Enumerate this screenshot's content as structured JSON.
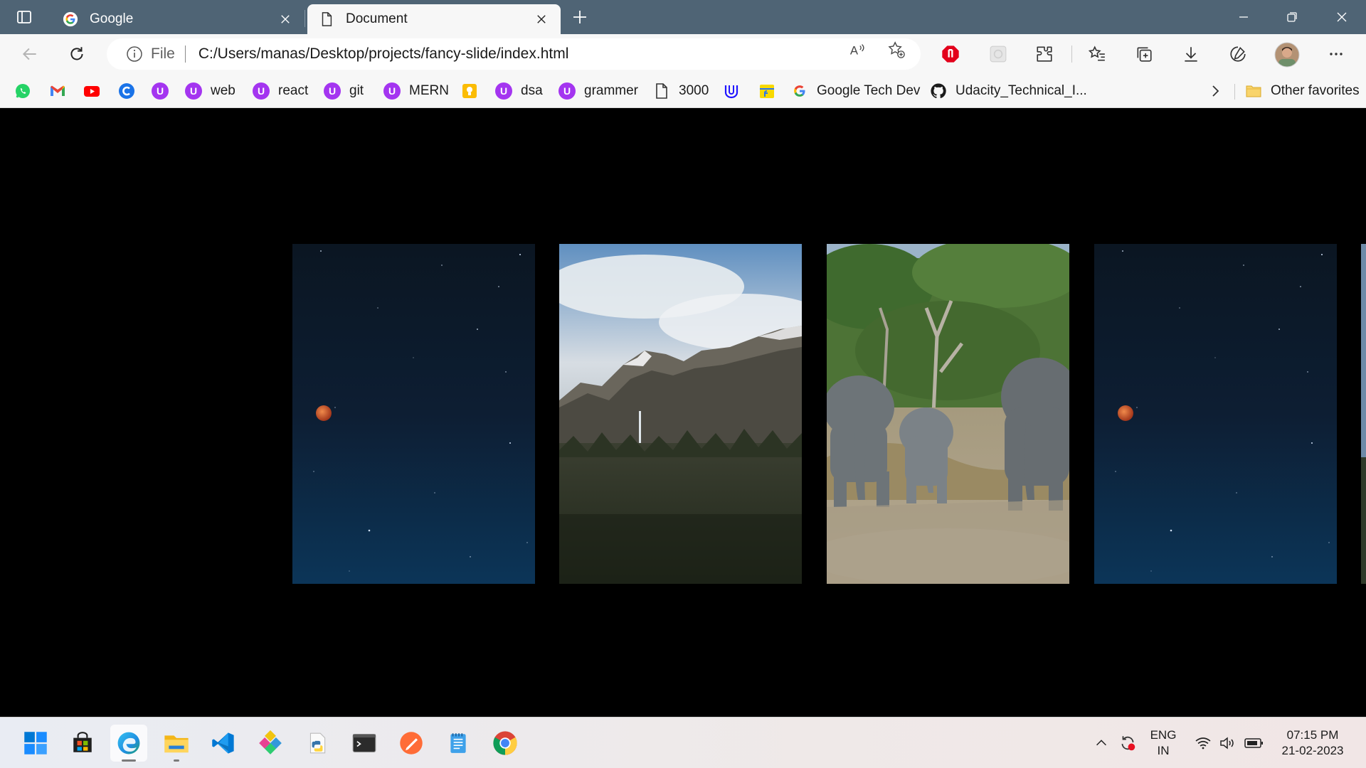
{
  "browser": {
    "tabs": [
      {
        "title": "Google",
        "favicon": "google-icon",
        "active": false
      },
      {
        "title": "Document",
        "favicon": "document-icon",
        "active": true
      }
    ],
    "address": {
      "scheme_label": "File",
      "url": "C:/Users/manas/Desktop/projects/fancy-slide/index.html"
    },
    "toolbar_icons": [
      "back-icon",
      "refresh-icon",
      "read-aloud-icon",
      "add-favorite-icon",
      "adblock-icon",
      "extension-placeholder-icon",
      "extensions-icon",
      "favorites-icon",
      "collections-icon",
      "downloads-icon",
      "performance-icon",
      "profile-avatar",
      "more-icon"
    ],
    "bookmarks": [
      {
        "label": "",
        "icon": "whatsapp-icon"
      },
      {
        "label": "",
        "icon": "gmail-icon"
      },
      {
        "label": "",
        "icon": "youtube-icon"
      },
      {
        "label": "",
        "icon": "c-app-icon"
      },
      {
        "label": "",
        "icon": "udemy-icon"
      },
      {
        "label": "web",
        "icon": "udemy-icon"
      },
      {
        "label": "react",
        "icon": "udemy-icon"
      },
      {
        "label": "git",
        "icon": "udemy-icon"
      },
      {
        "label": "MERN",
        "icon": "udemy-icon"
      },
      {
        "label": "",
        "icon": "keep-icon"
      },
      {
        "label": "dsa",
        "icon": "udemy-icon"
      },
      {
        "label": "grammer",
        "icon": "udemy-icon"
      },
      {
        "label": "3000",
        "icon": "page-icon"
      },
      {
        "label": "",
        "icon": "udacity-icon"
      },
      {
        "label": "",
        "icon": "flipkart-icon"
      },
      {
        "label": "Google Tech Dev",
        "icon": "google-icon"
      },
      {
        "label": "Udacity_Technical_I...",
        "icon": "github-icon"
      }
    ],
    "other_favorites": "Other favorites"
  },
  "slides": [
    {
      "name": "night-sky-moon",
      "colors": [
        "#0d1a2a",
        "#0b2a48"
      ]
    },
    {
      "name": "mountain-waterfall-forest",
      "colors": [
        "#7d9cbc",
        "#2f3a2b"
      ]
    },
    {
      "name": "elephants-grassland",
      "colors": [
        "#4e7a3a",
        "#a48f6c"
      ]
    },
    {
      "name": "night-sky-moon",
      "colors": [
        "#0d1a2a",
        "#0b2a48"
      ]
    }
  ],
  "taskbar": {
    "apps": [
      "windows-start-icon",
      "microsoft-store-icon",
      "edge-icon",
      "file-explorer-icon",
      "vscode-icon",
      "git-tool-icon",
      "python-file-icon",
      "terminal-icon",
      "postman-icon",
      "notepad-icon",
      "chrome-icon"
    ],
    "language": {
      "line1": "ENG",
      "line2": "IN"
    },
    "time": "07:15 PM",
    "date": "21-02-2023"
  }
}
